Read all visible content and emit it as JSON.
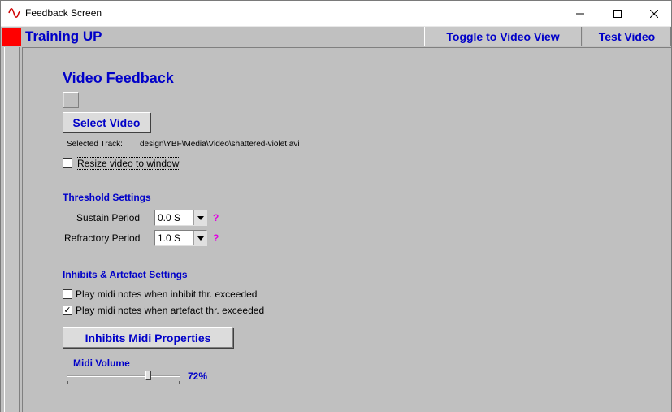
{
  "window": {
    "title": "Feedback Screen"
  },
  "header": {
    "title": "Training UP",
    "toggle_button": "Toggle to Video View",
    "test_button": "Test Video"
  },
  "video": {
    "section_title": "Video Feedback",
    "select_button": "Select Video",
    "selected_track_label": "Selected Track:",
    "selected_track_value": "design\\YBF\\Media\\Video\\shattered-violet.avi",
    "resize_label": "Resize video to window",
    "resize_checked": false
  },
  "threshold": {
    "section_title": "Threshold Settings",
    "sustain_label": "Sustain Period",
    "sustain_value": "0.0 S",
    "refractory_label": "Refractory Period",
    "refractory_value": "1.0 S",
    "help_glyph": "?"
  },
  "inhibits": {
    "section_title": "Inhibits & Artefact Settings",
    "inhibit_label": "Play midi notes when inhibit thr. exceeded",
    "inhibit_checked": false,
    "artefact_label": "Play midi notes when artefact thr. exceeded",
    "artefact_checked": true,
    "midi_button": "Inhibits Midi Properties"
  },
  "midi_volume": {
    "title": "Midi Volume",
    "value_text": "72%",
    "level": 0.72
  },
  "colors": {
    "accent_blue": "#0000c8",
    "help_magenta": "#e000e0",
    "indicator_red": "#ff0000",
    "panel_gray": "#c0c0c0"
  },
  "glyphs": {
    "check": "✓"
  }
}
